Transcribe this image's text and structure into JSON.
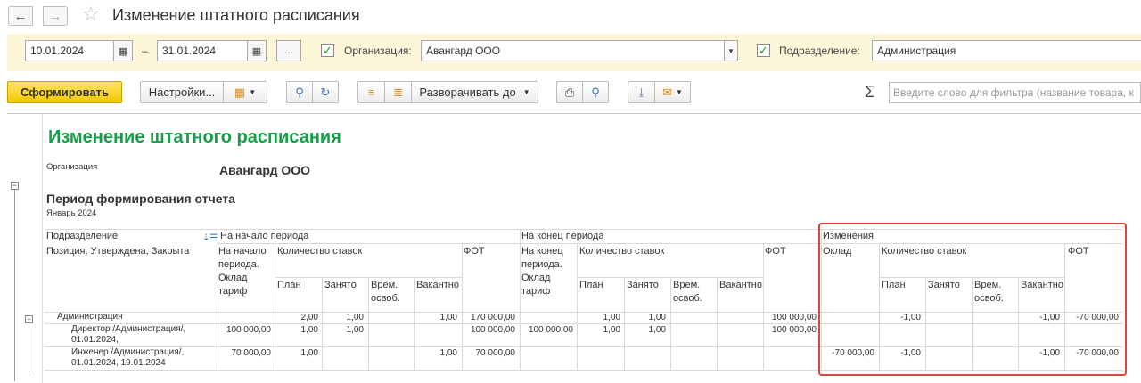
{
  "window": {
    "title": "Изменение штатного расписания"
  },
  "filters": {
    "date_from": "10.01.2024",
    "date_to": "31.01.2024",
    "dash": "–",
    "more_label": "...",
    "org_label": "Организация:",
    "org_value": "Авангард ООО",
    "dept_label": "Подразделение:",
    "dept_value": "Администрация"
  },
  "toolbar": {
    "generate_label": "Сформировать",
    "settings_label": "Настройки...",
    "expand_label": "Разворачивать до",
    "filter_placeholder": "Введите слово для фильтра (название товара, к"
  },
  "report": {
    "title": "Изменение штатного расписания",
    "org_caption": "Организация",
    "org_value": "Авангард ООО",
    "period_caption": "Период формирования отчета",
    "period_value": "Январь 2024",
    "headers": {
      "dept": "Подразделение",
      "position": "Позиция, Утверждена, Закрыта",
      "start_period": "На начало периода",
      "end_period": "На конец периода",
      "changes": "Изменения",
      "start_rate": "На начало периода. Оклад тариф",
      "end_rate": "На конец периода. Оклад тариф",
      "salary": "Оклад",
      "qty": "Количество ставок",
      "fot": "ФОТ",
      "plan": "План",
      "busy": "Занято",
      "temp": "Врем. освоб.",
      "vacant": "Вакантно"
    },
    "rows": [
      {
        "name": "Администрация",
        "s_rate": "",
        "s_plan": "2,00",
        "s_busy": "1,00",
        "s_temp": "",
        "s_vac": "1,00",
        "s_fot": "170 000,00",
        "e_rate": "",
        "e_plan": "1,00",
        "e_busy": "1,00",
        "e_temp": "",
        "e_vac": "",
        "e_fot": "100 000,00",
        "c_sal": "",
        "c_plan": "-1,00",
        "c_busy": "",
        "c_temp": "",
        "c_vac": "-1,00",
        "c_fot": "-70 000,00"
      },
      {
        "name": "Директор /Администрация/, 01.01.2024,",
        "s_rate": "100 000,00",
        "s_plan": "1,00",
        "s_busy": "1,00",
        "s_temp": "",
        "s_vac": "",
        "s_fot": "100 000,00",
        "e_rate": "100 000,00",
        "e_plan": "1,00",
        "e_busy": "1,00",
        "e_temp": "",
        "e_vac": "",
        "e_fot": "100 000,00",
        "c_sal": "",
        "c_plan": "",
        "c_busy": "",
        "c_temp": "",
        "c_vac": "",
        "c_fot": ""
      },
      {
        "name": "Инженер /Администрация/, 01.01.2024, 19.01.2024",
        "s_rate": "70 000,00",
        "s_plan": "1,00",
        "s_busy": "",
        "s_temp": "",
        "s_vac": "1,00",
        "s_fot": "70 000,00",
        "e_rate": "",
        "e_plan": "",
        "e_busy": "",
        "e_temp": "",
        "e_vac": "",
        "e_fot": "",
        "c_sal": "-70 000,00",
        "c_plan": "-1,00",
        "c_busy": "",
        "c_temp": "",
        "c_vac": "-1,00",
        "c_fot": "-70 000,00"
      }
    ]
  },
  "colors": {
    "title_green": "#12a047",
    "highlight_red": "#d9463c",
    "primary_yellow": "#f4c800"
  }
}
